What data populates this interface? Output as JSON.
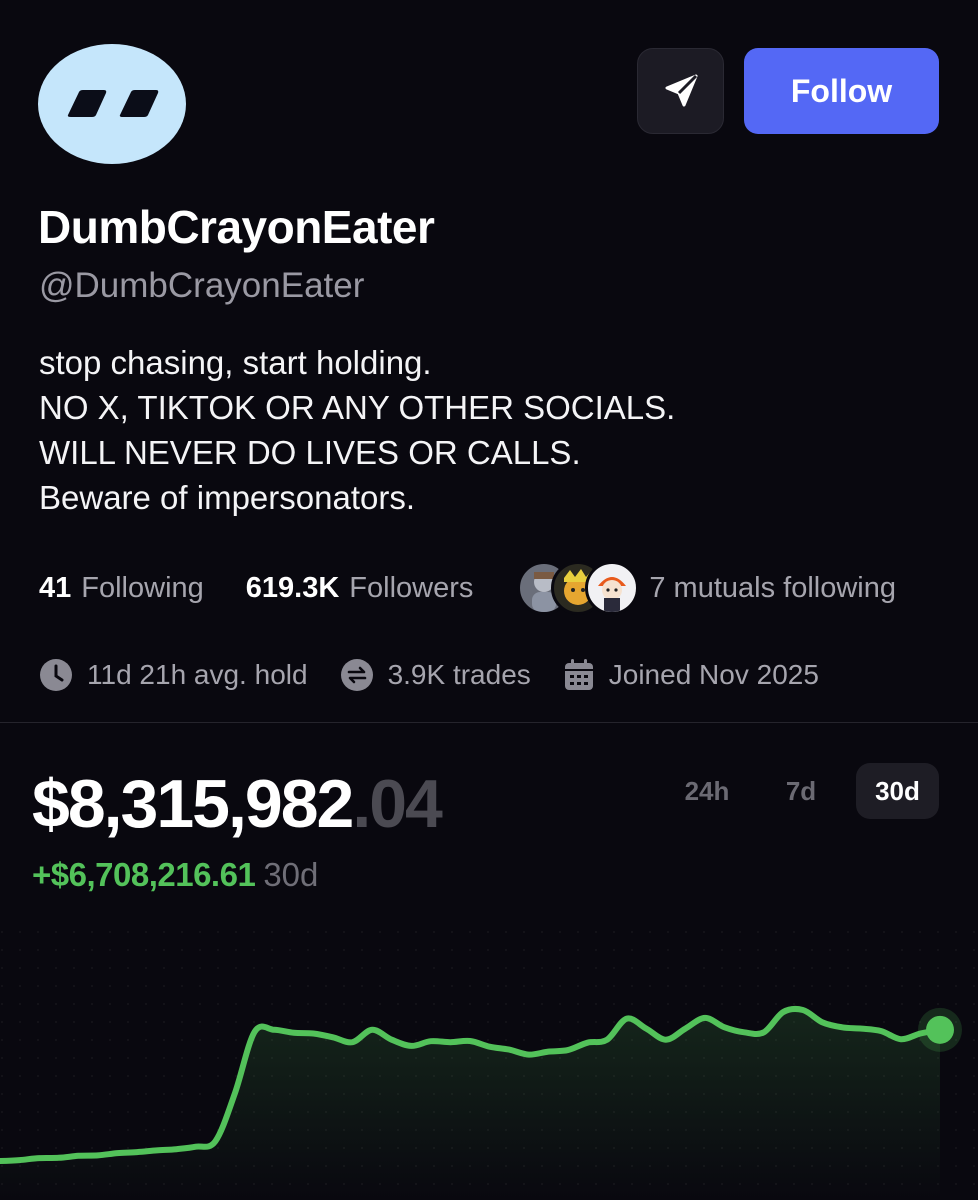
{
  "profile": {
    "display_name": "DumbCrayonEater",
    "handle": "@DumbCrayonEater",
    "bio_lines": [
      "stop chasing, start holding.",
      "NO X, TIKTOK OR ANY OTHER SOCIALS.",
      "WILL NEVER DO LIVES OR CALLS.",
      "Beware of impersonators."
    ],
    "avatar_icon": "double-slash-logo-icon",
    "avatar_color": "#c5e6fb"
  },
  "actions": {
    "share_icon": "send-icon",
    "follow_label": "Follow",
    "follow_color": "#5468f5"
  },
  "stats": {
    "following_count": "41",
    "following_label": "Following",
    "followers_count": "619.3K",
    "followers_label": "Followers",
    "mutuals_label": "7 mutuals following"
  },
  "meta": {
    "avg_hold": "11d 21h avg. hold",
    "trades": "3.9K trades",
    "joined": "Joined Nov 2025"
  },
  "portfolio": {
    "balance_main": "$8,315,982",
    "balance_decimal": ".04",
    "pnl_value": "+$6,708,216.61",
    "pnl_period": "30d",
    "positive_color": "#53c25a",
    "tabs": [
      {
        "label": "24h",
        "active": false
      },
      {
        "label": "7d",
        "active": false
      },
      {
        "label": "30d",
        "active": true
      }
    ]
  },
  "chart_data": {
    "type": "area",
    "series": [
      {
        "values": [
          0.2,
          0.24,
          0.32,
          0.33,
          0.41,
          0.43,
          0.52,
          0.56,
          0.63,
          0.68,
          0.78,
          1.0,
          2.95,
          5.42,
          5.5,
          5.38,
          5.35,
          5.2,
          5.0,
          5.5,
          5.1,
          4.85,
          5.04,
          5.0,
          5.05,
          4.82,
          4.7,
          4.5,
          4.62,
          4.68,
          4.98,
          5.1,
          5.95,
          5.55,
          5.1,
          5.55,
          5.98,
          5.6,
          5.4,
          5.4,
          6.22,
          6.3,
          5.8,
          5.6,
          5.55,
          5.45,
          5.12,
          5.35,
          5.5
        ]
      }
    ],
    "ylim": [
      0,
      8.32
    ],
    "grid": false
  }
}
